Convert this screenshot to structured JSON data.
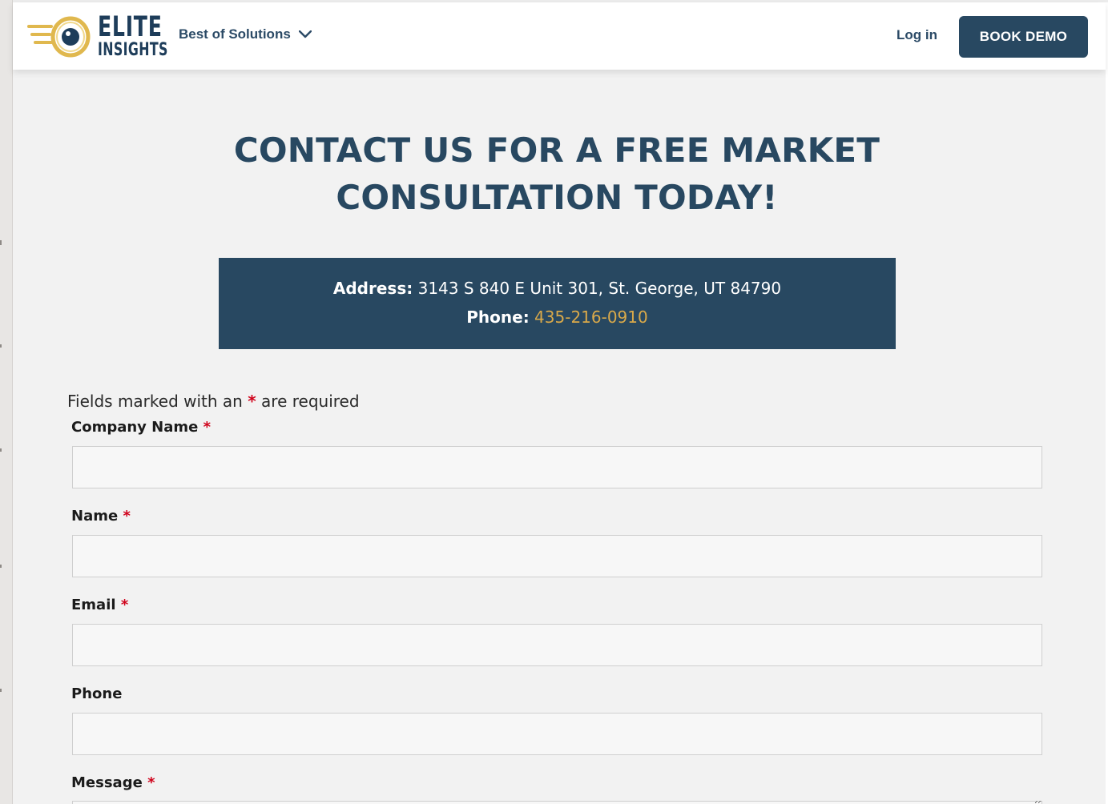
{
  "brand": {
    "logo_line1": "ELITE",
    "logo_line2": "INSIGHTS",
    "logo_icon": "eye-icon",
    "primary_color": "#284861",
    "accent_color": "#d9a94a"
  },
  "nav": {
    "dropdown_label": "Best of Solutions",
    "login_label": "Log in",
    "cta_label": "BOOK DEMO"
  },
  "hero": {
    "heading_line1": "CONTACT US FOR A FREE MARKET",
    "heading_line2": "CONSULTATION TODAY!"
  },
  "contact": {
    "address_label": "Address:",
    "address_value": " 3143 S 840 E Unit 301, St. George, UT 84790",
    "phone_label": "Phone:",
    "phone_value": "435-216-0910"
  },
  "form": {
    "required_note_before": "Fields marked with an ",
    "required_marker": "*",
    "required_note_after": " are required",
    "fields": [
      {
        "label": "Company Name",
        "required": true,
        "value": ""
      },
      {
        "label": "Name",
        "required": true,
        "value": ""
      },
      {
        "label": "Email",
        "required": true,
        "value": ""
      },
      {
        "label": "Phone",
        "required": false,
        "value": ""
      },
      {
        "label": "Message",
        "required": true,
        "value": ""
      }
    ]
  }
}
